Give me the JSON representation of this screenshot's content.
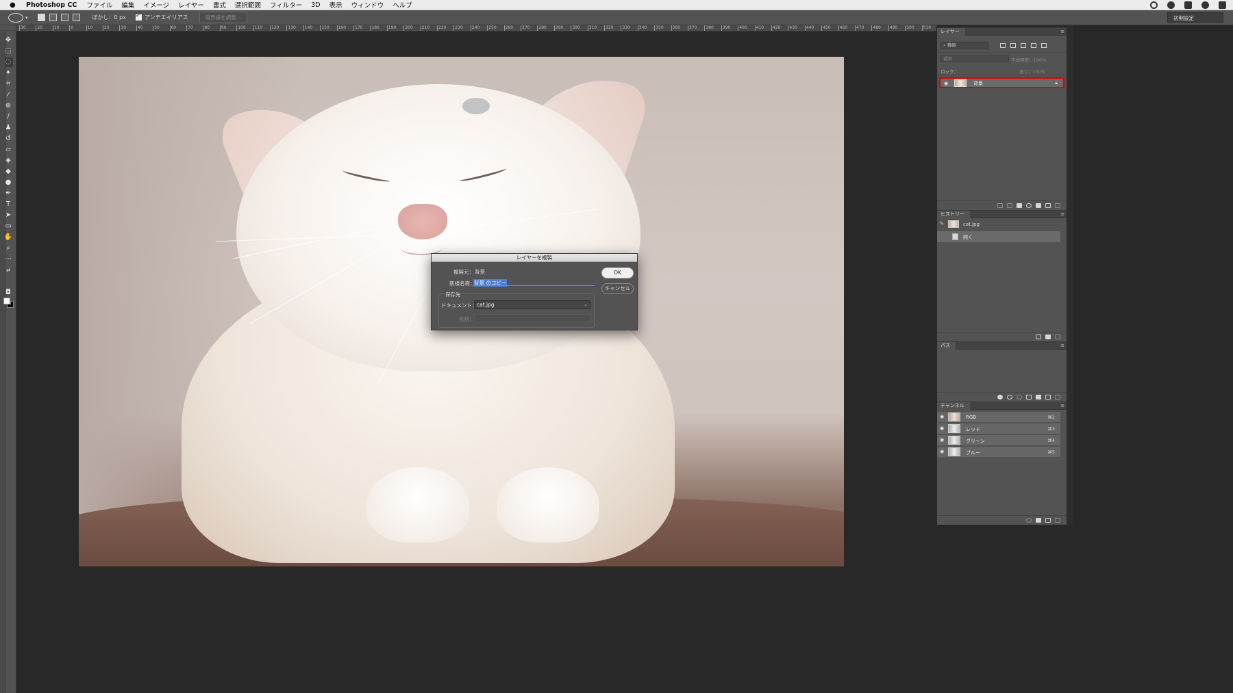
{
  "menubar": {
    "app_name": "Photoshop CC",
    "items": [
      "ファイル",
      "編集",
      "イメージ",
      "レイヤー",
      "書式",
      "選択範囲",
      "フィルター",
      "3D",
      "表示",
      "ウィンドウ",
      "ヘルプ"
    ]
  },
  "options_bar": {
    "feather_label": "ぼかし：0 px",
    "antialias_label": "アンチエイリアス",
    "refine_edge_label": "境界線を調整...",
    "workspace_label": "初期設定"
  },
  "ruler": {
    "h_ticks": [
      "30",
      "20",
      "10",
      "0",
      "10",
      "20",
      "30",
      "40",
      "50",
      "60",
      "70",
      "80",
      "90",
      "100",
      "110",
      "120",
      "130",
      "140",
      "150",
      "160",
      "170",
      "180",
      "190",
      "200",
      "210",
      "220",
      "230",
      "240",
      "250",
      "260",
      "270",
      "280",
      "290",
      "300",
      "310",
      "320",
      "330",
      "340",
      "350",
      "360",
      "370",
      "380",
      "390",
      "400",
      "410",
      "420",
      "430",
      "440",
      "450",
      "460",
      "470",
      "480",
      "490",
      "500",
      "510"
    ]
  },
  "dialog": {
    "title": "レイヤーを複製",
    "source_label": "複製元：",
    "source_value": "背景",
    "name_label": "新規名称：",
    "name_value": "背景 のコピー",
    "destination_group": "保存先",
    "document_label": "ドキュメント：",
    "document_value": "cat.jpg",
    "artboard_label": "名前：",
    "ok_label": "OK",
    "cancel_label": "キャンセル"
  },
  "layers_panel": {
    "tab": "レイヤー",
    "search_placeholder": "種類",
    "blend_mode": "通常",
    "opacity_label": "不透明度：100%",
    "lock_label": "ロック：",
    "fill_label": "塗り：100%",
    "layers": [
      {
        "name": "背景",
        "locked": true,
        "visible": true
      }
    ]
  },
  "history_panel": {
    "tab": "ヒストリー",
    "items": [
      {
        "label": "cat.jpg",
        "kind": "snapshot"
      },
      {
        "label": "開く",
        "kind": "state"
      }
    ]
  },
  "paths_panel": {
    "tab": "パス"
  },
  "channels_panel": {
    "tab": "チャンネル",
    "channels": [
      {
        "name": "RGB",
        "shortcut": "⌘2"
      },
      {
        "name": "レッド",
        "shortcut": "⌘3"
      },
      {
        "name": "グリーン",
        "shortcut": "⌘4"
      },
      {
        "name": "ブルー",
        "shortcut": "⌘5"
      }
    ]
  },
  "colors": {
    "highlight_border": "#e00000",
    "selection_blue": "#4b7bd6",
    "panel_bg": "#535353",
    "canvas_bg": "#282828"
  }
}
